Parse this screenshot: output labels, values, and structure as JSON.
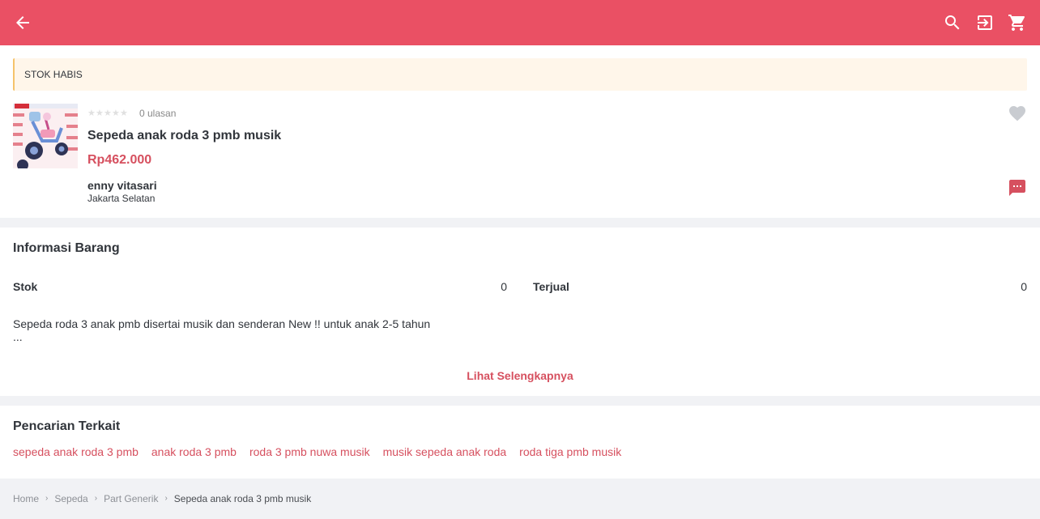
{
  "header": {
    "back_icon": "arrow-left-icon",
    "search_icon": "search-icon",
    "login_icon": "login-icon",
    "cart_icon": "cart-icon",
    "bg_color": "#ea5064"
  },
  "product": {
    "stock_banner": "STOK HABIS",
    "rating_stars": 0,
    "reviews": "0 ulasan",
    "title": "Sepeda anak roda 3 pmb musik",
    "price": "Rp462.000",
    "seller_name": "enny vitasari",
    "seller_city": "Jakarta Selatan",
    "price_color": "#d6505f"
  },
  "info": {
    "title": "Informasi Barang",
    "stock_label": "Stok",
    "stock_value": "0",
    "sold_label": "Terjual",
    "sold_value": "0",
    "description": "Sepeda roda 3 anak pmb disertai musik dan senderan New !! untuk anak 2-5 tahun",
    "ellipsis": "...",
    "see_more": "Lihat Selengkapnya"
  },
  "related": {
    "title": "Pencarian Terkait",
    "tags": [
      "sepeda anak roda 3 pmb",
      "anak roda 3 pmb",
      "roda 3 pmb nuwa musik",
      "musik sepeda anak roda",
      "roda tiga pmb musik"
    ]
  },
  "breadcrumb": {
    "items": [
      "Home",
      "Sepeda",
      "Part Generik"
    ],
    "current": "Sepeda anak roda 3 pmb musik"
  }
}
